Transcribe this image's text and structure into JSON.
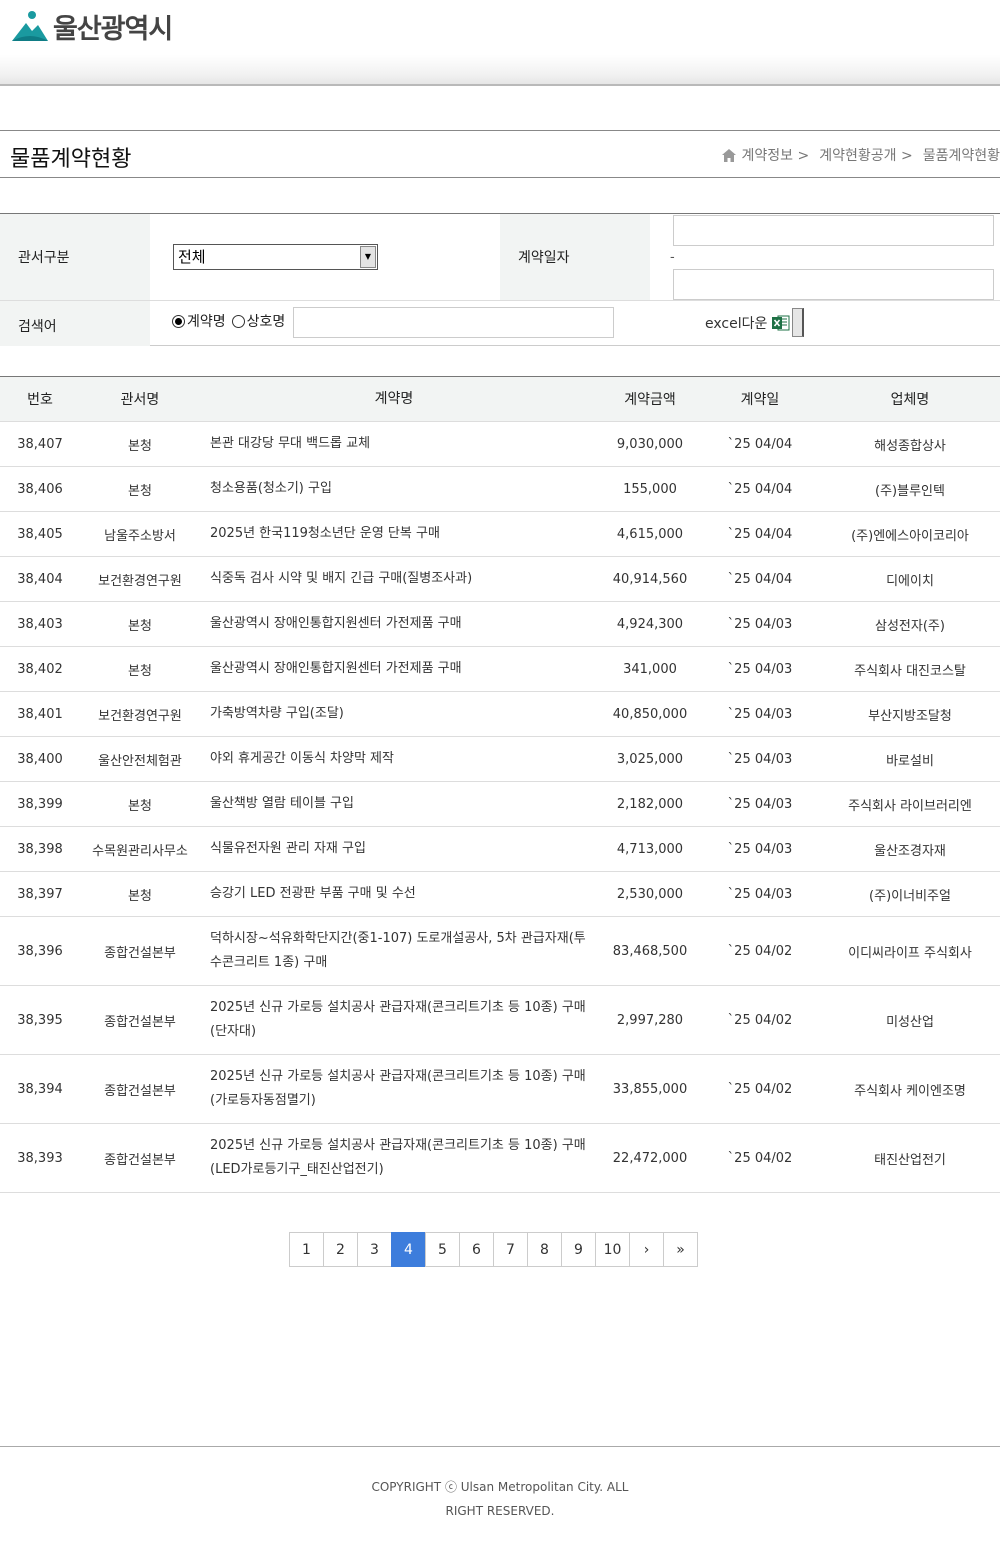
{
  "header": {
    "logo_text": "울산광역시"
  },
  "titlebar": {
    "title": "물품계약현황",
    "breadcrumb": [
      "계약정보 >",
      "계약현황공개 >",
      "물품계약현황"
    ]
  },
  "search": {
    "dept_label": "관서구분",
    "dept_selected": "전체",
    "date_label": "계약일자",
    "date_separator": "-",
    "keyword_label": "검색어",
    "radio_contract": "계약명",
    "radio_company": "상호명",
    "excel_label": "excel다운"
  },
  "table": {
    "headers": {
      "no": "번호",
      "dept": "관서명",
      "name": "계약명",
      "amount": "계약금액",
      "date": "계약일",
      "vendor": "업체명"
    },
    "rows": [
      {
        "no": "38,407",
        "dept": "본청",
        "name": "본관 대강당 무대 백드롭 교체",
        "amount": "9,030,000",
        "date": "`25 04/04",
        "vendor": "해성종합상사"
      },
      {
        "no": "38,406",
        "dept": "본청",
        "name": "청소용품(청소기) 구입",
        "amount": "155,000",
        "date": "`25 04/04",
        "vendor": "(주)블루인텍"
      },
      {
        "no": "38,405",
        "dept": "남울주소방서",
        "name": "2025년 한국119청소년단 운영 단복 구매",
        "amount": "4,615,000",
        "date": "`25 04/04",
        "vendor": "(주)엔에스아이코리아"
      },
      {
        "no": "38,404",
        "dept": "보건환경연구원",
        "name": "식중독 검사 시약 및 배지 긴급 구매(질병조사과)",
        "amount": "40,914,560",
        "date": "`25 04/04",
        "vendor": "디에이치"
      },
      {
        "no": "38,403",
        "dept": "본청",
        "name": "울산광역시 장애인통합지원센터 가전제품 구매",
        "amount": "4,924,300",
        "date": "`25 04/03",
        "vendor": "삼성전자(주)"
      },
      {
        "no": "38,402",
        "dept": "본청",
        "name": "울산광역시 장애인통합지원센터 가전제품 구매",
        "amount": "341,000",
        "date": "`25 04/03",
        "vendor": "주식회사 대진코스탈"
      },
      {
        "no": "38,401",
        "dept": "보건환경연구원",
        "name": "가축방역차량 구입(조달)",
        "amount": "40,850,000",
        "date": "`25 04/03",
        "vendor": "부산지방조달청"
      },
      {
        "no": "38,400",
        "dept": "울산안전체험관",
        "name": "야외 휴게공간 이동식 차양막 제작",
        "amount": "3,025,000",
        "date": "`25 04/03",
        "vendor": "바로설비"
      },
      {
        "no": "38,399",
        "dept": "본청",
        "name": "울산책방 열람 테이블 구입",
        "amount": "2,182,000",
        "date": "`25 04/03",
        "vendor": "주식회사 라이브러리엔"
      },
      {
        "no": "38,398",
        "dept": "수목원관리사무소",
        "name": "식물유전자원 관리 자재 구입",
        "amount": "4,713,000",
        "date": "`25 04/03",
        "vendor": "울산조경자재"
      },
      {
        "no": "38,397",
        "dept": "본청",
        "name": "승강기 LED 전광판 부품 구매 및 수선",
        "amount": "2,530,000",
        "date": "`25 04/03",
        "vendor": "(주)이너비주얼"
      },
      {
        "no": "38,396",
        "dept": "종합건설본부",
        "name": "덕하시장~석유화학단지간(중1-107) 도로개설공사, 5차 관급자재(투수콘크리트 1종) 구매",
        "amount": "83,468,500",
        "date": "`25 04/02",
        "vendor": "이디씨라이프 주식회사"
      },
      {
        "no": "38,395",
        "dept": "종합건설본부",
        "name": "2025년 신규 가로등 설치공사 관급자재(콘크리트기초 등 10종) 구매(단자대)",
        "amount": "2,997,280",
        "date": "`25 04/02",
        "vendor": "미성산업"
      },
      {
        "no": "38,394",
        "dept": "종합건설본부",
        "name": "2025년 신규 가로등 설치공사 관급자재(콘크리트기초 등 10종) 구매(가로등자동점멸기)",
        "amount": "33,855,000",
        "date": "`25 04/02",
        "vendor": "주식회사 케이엔조명"
      },
      {
        "no": "38,393",
        "dept": "종합건설본부",
        "name": "2025년 신규 가로등 설치공사 관급자재(콘크리트기초 등 10종) 구매(LED가로등기구_태진산업전기)",
        "amount": "22,472,000",
        "date": "`25 04/02",
        "vendor": "태진산업전기"
      }
    ]
  },
  "pagination": {
    "pages": [
      "1",
      "2",
      "3",
      "4",
      "5",
      "6",
      "7",
      "8",
      "9",
      "10"
    ],
    "current": "4",
    "next": "›",
    "last": "»"
  },
  "footer": {
    "copyright": "COPYRIGHT ⓒ Ulsan Metropolitan City. ALL RIGHT RESERVED."
  },
  "colors": {
    "active_page": "#3d7ddc",
    "header_cell_bg": "#f2f4f3",
    "logo_teal": "#1a9aa0"
  },
  "icons": {
    "logo": "ulsan-logo-icon",
    "home": "home-icon",
    "excel": "excel-icon",
    "select": "chevron-down-icon"
  }
}
